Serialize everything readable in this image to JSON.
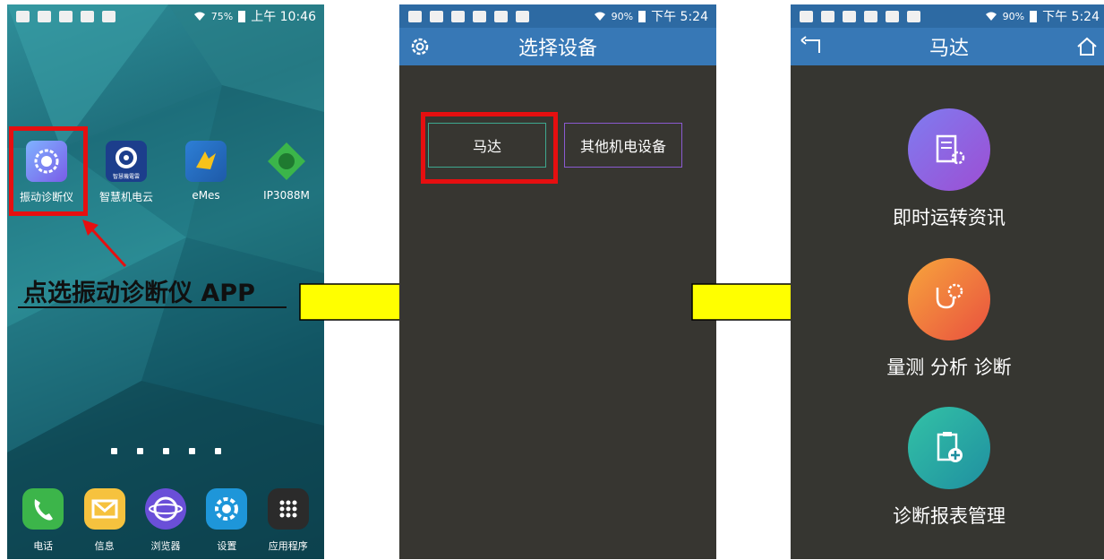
{
  "screen1": {
    "status_time": "上午 10:46",
    "status_battery": "75%",
    "apps": [
      {
        "label": "振动诊断仪",
        "icon": "vibration-app-icon"
      },
      {
        "label": "智慧机电云",
        "icon": "cloud-app-icon",
        "caption": "智慧機電雲"
      },
      {
        "label": "eMes",
        "icon": "emes-app-icon"
      },
      {
        "label": "IP3088M",
        "icon": "ip3088m-app-icon"
      }
    ],
    "dock": [
      {
        "label": "电话",
        "icon": "phone-icon"
      },
      {
        "label": "信息",
        "icon": "message-icon"
      },
      {
        "label": "浏览器",
        "icon": "browser-icon"
      },
      {
        "label": "设置",
        "icon": "settings-icon"
      },
      {
        "label": "应用程序",
        "icon": "apps-icon"
      }
    ],
    "callout": "点选振动诊断仪 APP"
  },
  "screen2": {
    "status_time": "下午 5:24",
    "status_battery": "90%",
    "title": "选择设备",
    "devices": [
      "马达",
      "其他机电设备"
    ]
  },
  "screen3": {
    "status_time": "下午 5:24",
    "status_battery": "90%",
    "title": "马达",
    "menu": [
      {
        "label": "即时运转资讯",
        "icon": "report-gear-icon"
      },
      {
        "label": "量测 分析 诊断",
        "icon": "stethoscope-icon"
      },
      {
        "label": "诊断报表管理",
        "icon": "clipboard-add-icon"
      }
    ]
  },
  "colors": {
    "highlight": "#e60f10",
    "arrow_fill": "#ffff00",
    "appbar": "#3778b6",
    "dark_bg": "#373631"
  }
}
